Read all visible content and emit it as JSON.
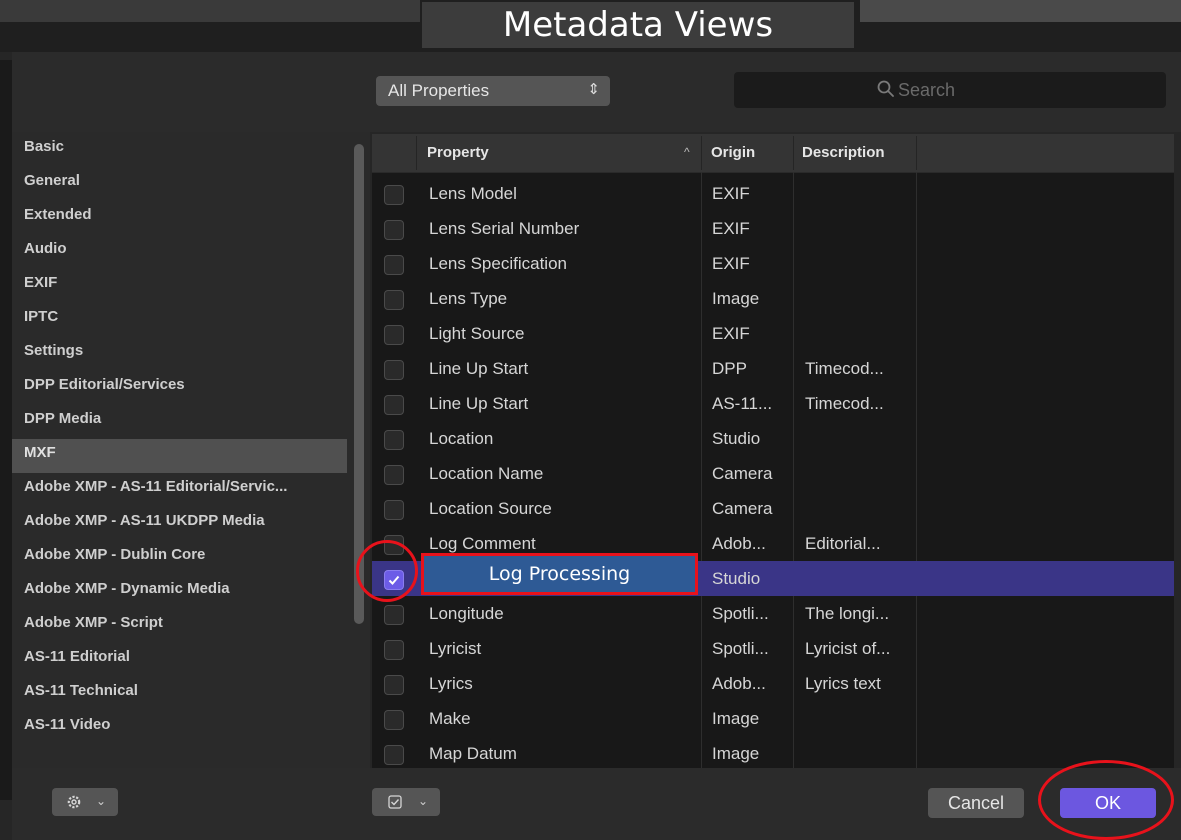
{
  "window": {
    "title": "Metadata Views"
  },
  "toolbar": {
    "filter_label": "All Properties",
    "search_placeholder": "Search"
  },
  "sidebar": {
    "items": [
      {
        "label": "Basic",
        "selected": false
      },
      {
        "label": "General",
        "selected": false
      },
      {
        "label": "Extended",
        "selected": false
      },
      {
        "label": "Audio",
        "selected": false
      },
      {
        "label": "EXIF",
        "selected": false
      },
      {
        "label": "IPTC",
        "selected": false
      },
      {
        "label": "Settings",
        "selected": false
      },
      {
        "label": "DPP Editorial/Services",
        "selected": false
      },
      {
        "label": "DPP Media",
        "selected": false
      },
      {
        "label": "MXF",
        "selected": true
      },
      {
        "label": "Adobe XMP - AS-11 Editorial/Servic...",
        "selected": false
      },
      {
        "label": "Adobe XMP - AS-11 UKDPP Media",
        "selected": false
      },
      {
        "label": "Adobe XMP - Dublin Core",
        "selected": false
      },
      {
        "label": "Adobe XMP - Dynamic Media",
        "selected": false
      },
      {
        "label": "Adobe XMP - Script",
        "selected": false
      },
      {
        "label": "AS-11 Editorial",
        "selected": false
      },
      {
        "label": "AS-11 Technical",
        "selected": false
      },
      {
        "label": "AS-11 Video",
        "selected": false
      }
    ]
  },
  "table": {
    "columns": {
      "property": "Property",
      "origin": "Origin",
      "description": "Description"
    },
    "rows": [
      {
        "property": "Lens Model",
        "origin": "EXIF",
        "description": "",
        "checked": false,
        "selected": false
      },
      {
        "property": "Lens Serial Number",
        "origin": "EXIF",
        "description": "",
        "checked": false,
        "selected": false
      },
      {
        "property": "Lens Specification",
        "origin": "EXIF",
        "description": "",
        "checked": false,
        "selected": false
      },
      {
        "property": "Lens Type",
        "origin": "Image",
        "description": "",
        "checked": false,
        "selected": false
      },
      {
        "property": "Light Source",
        "origin": "EXIF",
        "description": "",
        "checked": false,
        "selected": false
      },
      {
        "property": "Line Up Start",
        "origin": "DPP",
        "description": "Timecod...",
        "checked": false,
        "selected": false
      },
      {
        "property": "Line Up Start",
        "origin": "AS-11...",
        "description": "Timecod...",
        "checked": false,
        "selected": false
      },
      {
        "property": "Location",
        "origin": "Studio",
        "description": "",
        "checked": false,
        "selected": false
      },
      {
        "property": "Location Name",
        "origin": "Camera",
        "description": "",
        "checked": false,
        "selected": false
      },
      {
        "property": "Location Source",
        "origin": "Camera",
        "description": "",
        "checked": false,
        "selected": false
      },
      {
        "property": "Log Comment",
        "origin": "Adob...",
        "description": "Editorial...",
        "checked": false,
        "selected": false
      },
      {
        "property": "Log Processing",
        "origin": "Studio",
        "description": "",
        "checked": true,
        "selected": true
      },
      {
        "property": "Longitude",
        "origin": "Spotli...",
        "description": "The longi...",
        "checked": false,
        "selected": false
      },
      {
        "property": "Lyricist",
        "origin": "Spotli...",
        "description": "Lyricist of...",
        "checked": false,
        "selected": false
      },
      {
        "property": "Lyrics",
        "origin": "Adob...",
        "description": "Lyrics text",
        "checked": false,
        "selected": false
      },
      {
        "property": "Make",
        "origin": "Image",
        "description": "",
        "checked": false,
        "selected": false
      },
      {
        "property": "Map Datum",
        "origin": "Image",
        "description": "",
        "checked": false,
        "selected": false
      }
    ]
  },
  "annotation": {
    "callout_label": "Log Processing"
  },
  "footer": {
    "cancel_label": "Cancel",
    "ok_label": "OK"
  },
  "colors": {
    "accent": "#6c57e0",
    "selection": "#3a3587",
    "highlight_red": "#e8121b",
    "callout_fill": "#2e5a95"
  }
}
